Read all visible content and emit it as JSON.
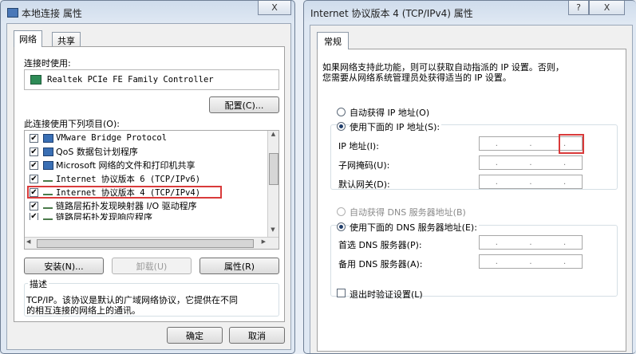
{
  "left_window": {
    "title": "本地连接 属性",
    "close": "X",
    "tabs": [
      "网络",
      "共享"
    ],
    "connect_using_label": "连接时使用:",
    "adapter_name": "Realtek PCIe FE Family Controller",
    "configure_button": "配置(C)...",
    "items_label": "此连接使用下列项目(O):",
    "items": [
      "VMware Bridge Protocol",
      "QoS 数据包计划程序",
      "Microsoft 网络的文件和打印机共享",
      "Internet 协议版本 6 (TCP/IPv6)",
      "Internet 协议版本 4 (TCP/IPv4)",
      "链路层拓扑发现映射器 I/O 驱动程序",
      "链路层拓扑发现响应程序"
    ],
    "install_button": "安装(N)...",
    "uninstall_button": "卸载(U)",
    "properties_button": "属性(R)",
    "description_label": "描述",
    "description_text_1": "TCP/IP。该协议是默认的广域网络协议，它提供在不同",
    "description_text_2": "的相互连接的网络上的通讯。",
    "ok_button": "确定",
    "cancel_button": "取消"
  },
  "right_window": {
    "title": "Internet 协议版本 4 (TCP/IPv4) 属性",
    "help": "?",
    "close": "X",
    "tab": "常规",
    "intro_line_1": "如果网络支持此功能，则可以获取自动指派的 IP 设置。否则，",
    "intro_line_2": "您需要从网络系统管理员处获得适当的 IP 设置。",
    "auto_ip": "自动获得 IP 地址(O)",
    "manual_ip": "使用下面的 IP 地址(S):",
    "ip_label": "IP 地址(I):",
    "subnet_label": "子网掩码(U):",
    "gateway_label": "默认网关(D):",
    "auto_dns": "自动获得 DNS 服务器地址(B)",
    "manual_dns": "使用下面的 DNS 服务器地址(E):",
    "preferred_dns_label": "首选 DNS 服务器(P):",
    "alternate_dns_label": "备用 DNS 服务器(A):",
    "validate_on_exit": "退出时验证设置(L)"
  }
}
